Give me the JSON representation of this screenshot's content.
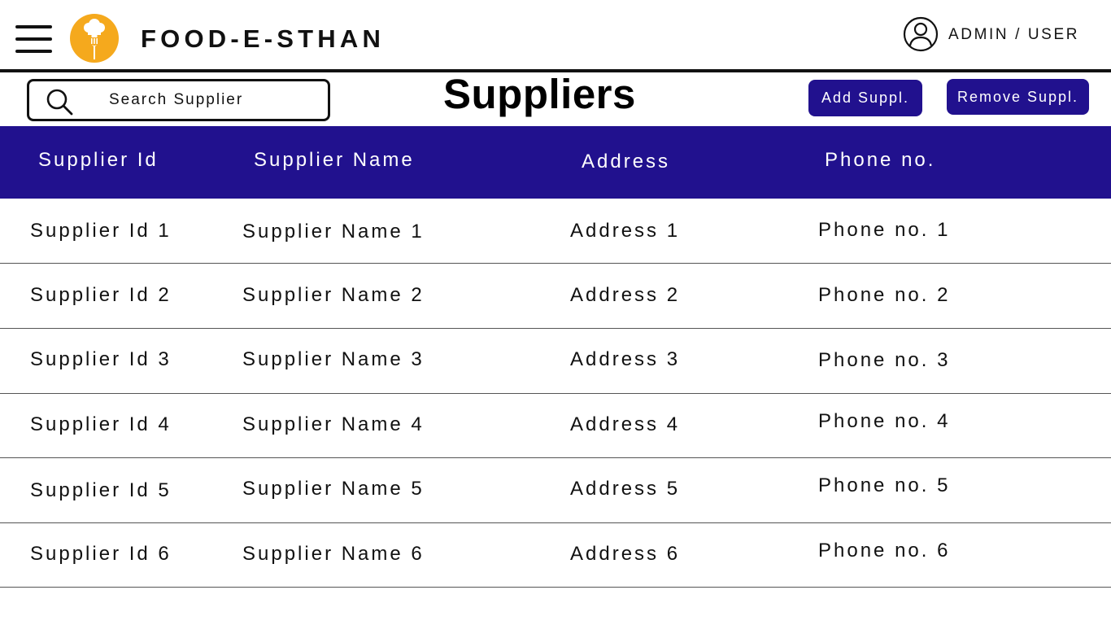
{
  "app": {
    "brand": "FOOD-E-STHAN",
    "user_label": "ADMIN / USER"
  },
  "toolbar": {
    "search_placeholder": "Search Supplier",
    "page_title": "Suppliers",
    "add_label": "Add Suppl.",
    "remove_label": "Remove Suppl."
  },
  "colors": {
    "accent": "#21118e",
    "logo": "#f5a91d"
  },
  "table": {
    "columns": [
      "Supplier Id",
      "Supplier Name",
      "Address",
      "Phone no."
    ],
    "rows": [
      [
        "Supplier Id 1",
        "Supplier Name 1",
        "Address 1",
        "Phone no. 1"
      ],
      [
        "Supplier Id 2",
        "Supplier Name 2",
        "Address 2",
        "Phone no. 2"
      ],
      [
        "Supplier Id 3",
        "Supplier Name 3",
        "Address 3",
        "Phone no. 3"
      ],
      [
        "Supplier Id 4",
        "Supplier Name 4",
        "Address 4",
        "Phone no. 4"
      ],
      [
        "Supplier Id 5",
        "Supplier Name 5",
        "Address 5",
        "Phone no. 5"
      ],
      [
        "Supplier Id 6",
        "Supplier Name 6",
        "Address 6",
        "Phone no. 6"
      ]
    ]
  }
}
